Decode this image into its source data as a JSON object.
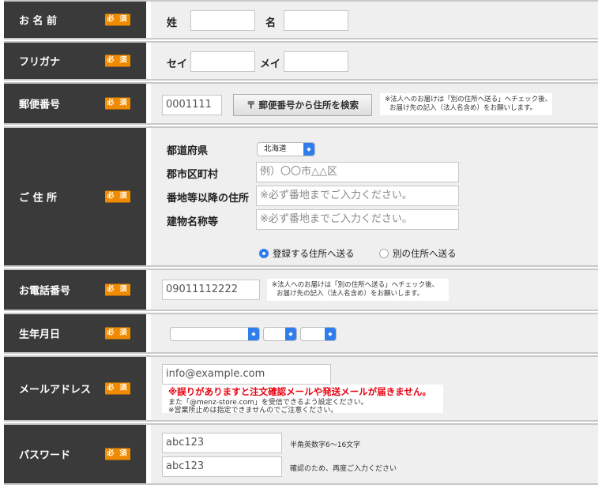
{
  "required_badge": "必 須",
  "name": {
    "label": "お 名 前",
    "last_label": "姓",
    "first_label": "名",
    "last_value": "",
    "first_value": ""
  },
  "furigana": {
    "label": "フリガナ",
    "last_label": "セイ",
    "first_label": "メイ",
    "last_value": "",
    "first_value": ""
  },
  "postal": {
    "label": "郵便番号",
    "value": "0001111",
    "search_button": "〒 郵便番号から住所を検索",
    "note_line1": "※法人へのお届けは「別の住所へ送る」へチェック後、",
    "note_line2": "お届け先の記入（法人名含め）をお願いします。"
  },
  "address": {
    "label": "ご 住 所",
    "prefecture_label": "都道府県",
    "prefecture_value": "北海道",
    "city_label": "郡市区町村",
    "city_placeholder": "例）〇〇市△△区",
    "street_label": "番地等以降の住所",
    "street_placeholder": "※必ず番地までご入力ください。",
    "building_label": "建物名称等",
    "building_placeholder": "※必ず番地までご入力ください。",
    "radio_registered": "登録する住所へ送る",
    "radio_other": "別の住所へ送る",
    "selected_option": "registered"
  },
  "phone": {
    "label": "お電話番号",
    "value": "09011112222",
    "note_line1": "※法人へのお届けは「別の住所へ送る」へチェック後、",
    "note_line2": "お届け先の記入（法人名含め）をお願いします。"
  },
  "birthday": {
    "label": "生年月日",
    "year_value": "",
    "month_value": "",
    "day_value": ""
  },
  "email": {
    "label": "メールアドレス",
    "value": "info@example.com",
    "warning": "※誤りがありますと注文確認メールや発送メールが届きません。",
    "note_line1": "また「@menz-store.com」を受信できるよう設定ください。",
    "note_line2": "※営業所止めは指定できませんのでご注意ください。"
  },
  "password": {
    "label": "パスワード",
    "value1": "abc123",
    "value2": "abc123",
    "hint1": "半角英数字6〜16文字",
    "hint2": "確認のため、再度ご入力ください"
  },
  "colors": {
    "header_bg": "#3a3a3a",
    "body_bg": "#efefef",
    "required_badge": "#f08b00",
    "accent": "#2f7ded",
    "warning": "#e8000f"
  }
}
